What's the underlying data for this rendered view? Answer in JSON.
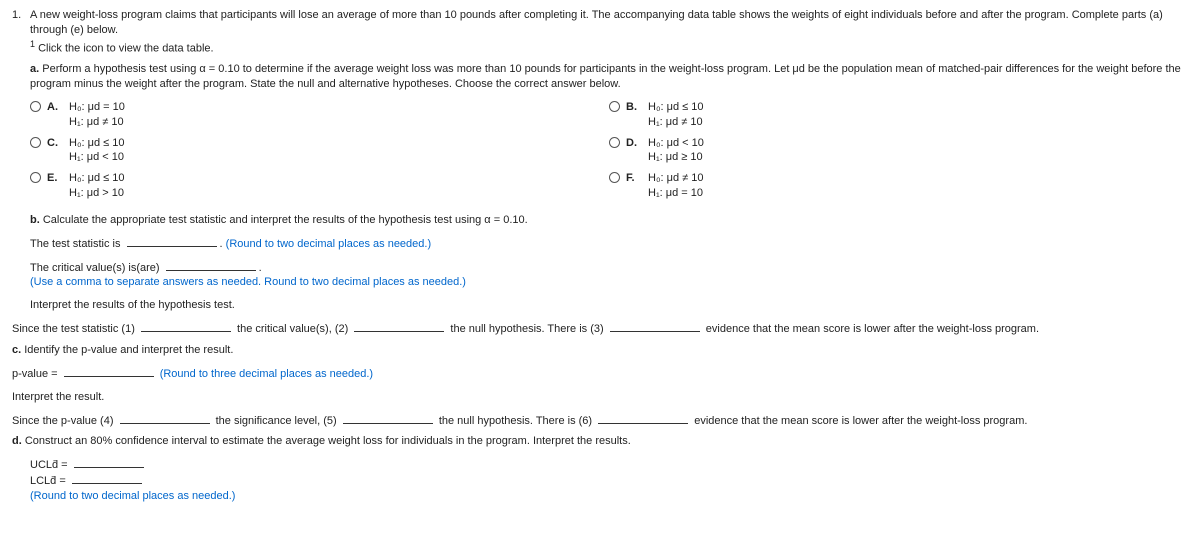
{
  "question": {
    "number": "1.",
    "prompt": "A new weight-loss program claims that participants will lose an average of more than 10 pounds after completing it. The accompanying data table shows the weights of eight individuals before and after the program. Complete parts (a) through (e) below.",
    "footnote_mark": "1",
    "footnote": "Click the icon to view the data table."
  },
  "a": {
    "label": "a.",
    "text": "Perform a hypothesis test using α = 0.10 to determine if the average weight loss was more than 10 pounds for participants in the weight-loss program. Let μd be the population mean of matched-pair differences for the weight before the program minus the weight after the program. State the null and alternative hypotheses. Choose the correct answer below.",
    "options": {
      "A": {
        "label": "A.",
        "l1": "H₀: μd = 10",
        "l2": "H₁: μd ≠ 10"
      },
      "B": {
        "label": "B.",
        "l1": "H₀: μd ≤ 10",
        "l2": "H₁: μd ≠ 10"
      },
      "C": {
        "label": "C.",
        "l1": "H₀: μd ≤ 10",
        "l2": "H₁: μd < 10"
      },
      "D": {
        "label": "D.",
        "l1": "H₀: μd < 10",
        "l2": "H₁: μd ≥ 10"
      },
      "E": {
        "label": "E.",
        "l1": "H₀: μd ≤ 10",
        "l2": "H₁: μd > 10"
      },
      "F": {
        "label": "F.",
        "l1": "H₀: μd ≠ 10",
        "l2": "H₁: μd = 10"
      }
    }
  },
  "b": {
    "label": "b.",
    "text": "Calculate the appropriate test statistic and interpret the results of the hypothesis test using α = 0.10.",
    "line1_pre": "The test statistic is",
    "line1_post": ".",
    "hint1": "(Round to two decimal places as needed.)",
    "line2": "The critical value(s) is(are)",
    "line2_post": ".",
    "hint2": "(Use a comma to separate answers as needed. Round to two decimal places as needed.)",
    "interpret": "Interpret the results of the hypothesis test."
  },
  "fill1": {
    "pre": "Since the test statistic  (1)",
    "mid1": "the critical value(s),  (2)",
    "mid2": "the null hypothesis. There is  (3)",
    "post": "evidence that the mean score is lower after the weight-loss program."
  },
  "c": {
    "label": "c.",
    "text": "Identify the p-value and interpret the result.",
    "pval": "p-value =",
    "hint": "(Round to three decimal places as needed.)",
    "interpret": "Interpret the result."
  },
  "fill2": {
    "pre": "Since the p-value  (4)",
    "mid1": "the significance level,  (5)",
    "mid2": "the null hypothesis. There is  (6)",
    "post": "evidence that the mean score is lower after the weight-loss program."
  },
  "d": {
    "label": "d.",
    "text": "Construct an 80% confidence interval to estimate the average weight loss for individuals in the program. Interpret the results.",
    "ucl": "UCLd̄ =",
    "lcl": "LCLd̄ =",
    "hint": "(Round to two decimal places as needed.)"
  }
}
